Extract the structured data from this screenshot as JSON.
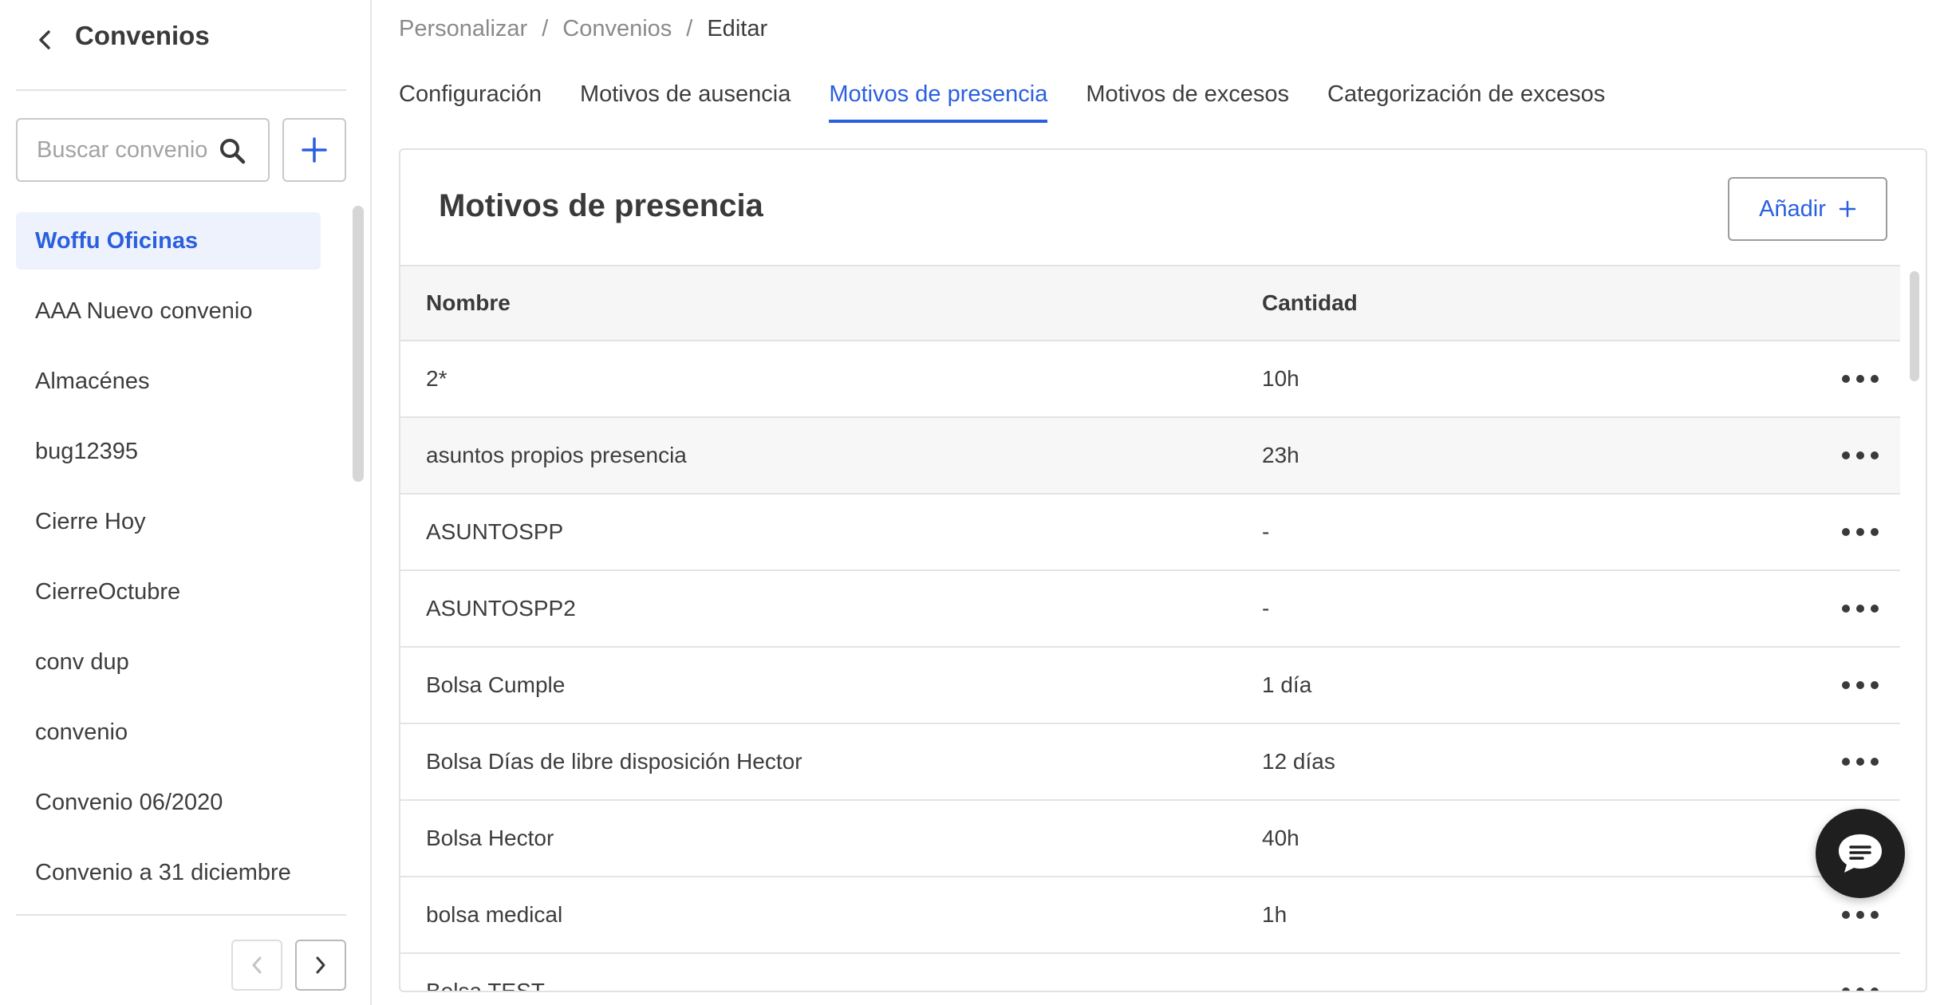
{
  "sidebar": {
    "title": "Convenios",
    "search_placeholder": "Buscar convenio",
    "items": [
      {
        "label": "Woffu Oficinas",
        "active": true
      },
      {
        "label": "AAA Nuevo convenio"
      },
      {
        "label": "Almacénes"
      },
      {
        "label": "bug12395"
      },
      {
        "label": "Cierre Hoy"
      },
      {
        "label": "CierreOctubre"
      },
      {
        "label": "conv dup"
      },
      {
        "label": "convenio"
      },
      {
        "label": "Convenio 06/2020"
      },
      {
        "label": "Convenio a 31 diciembre"
      }
    ]
  },
  "breadcrumb": {
    "items": [
      "Personalizar",
      "Convenios"
    ],
    "current": "Editar",
    "separator": "/"
  },
  "tabs": [
    {
      "label": "Configuración"
    },
    {
      "label": "Motivos de ausencia"
    },
    {
      "label": "Motivos de presencia",
      "active": true
    },
    {
      "label": "Motivos de excesos"
    },
    {
      "label": "Categorización de excesos"
    }
  ],
  "card": {
    "title": "Motivos de presencia",
    "add_label": "Añadir"
  },
  "table": {
    "columns": [
      "Nombre",
      "Cantidad"
    ],
    "rows": [
      {
        "name": "2*",
        "qty": "10h"
      },
      {
        "name": "asuntos propios presencia",
        "qty": "23h"
      },
      {
        "name": "ASUNTOSPP",
        "qty": "-"
      },
      {
        "name": "ASUNTOSPP2",
        "qty": "-"
      },
      {
        "name": "Bolsa Cumple",
        "qty": "1 día"
      },
      {
        "name": "Bolsa Días de libre disposición Hector",
        "qty": "12 días"
      },
      {
        "name": "Bolsa Hector",
        "qty": "40h"
      },
      {
        "name": "bolsa medical",
        "qty": "1h"
      },
      {
        "name": "Bolsa TEST",
        "qty": ""
      }
    ]
  },
  "colors": {
    "accent": "#2a5fdf",
    "active_bg": "#eef2fd",
    "chat_fab": "#1f1f1f"
  },
  "icons": {
    "back": "chevron-left-icon",
    "search": "search-icon",
    "add": "plus-icon",
    "more": "more-horizontal-icon",
    "chat": "chat-bubble-icon"
  }
}
